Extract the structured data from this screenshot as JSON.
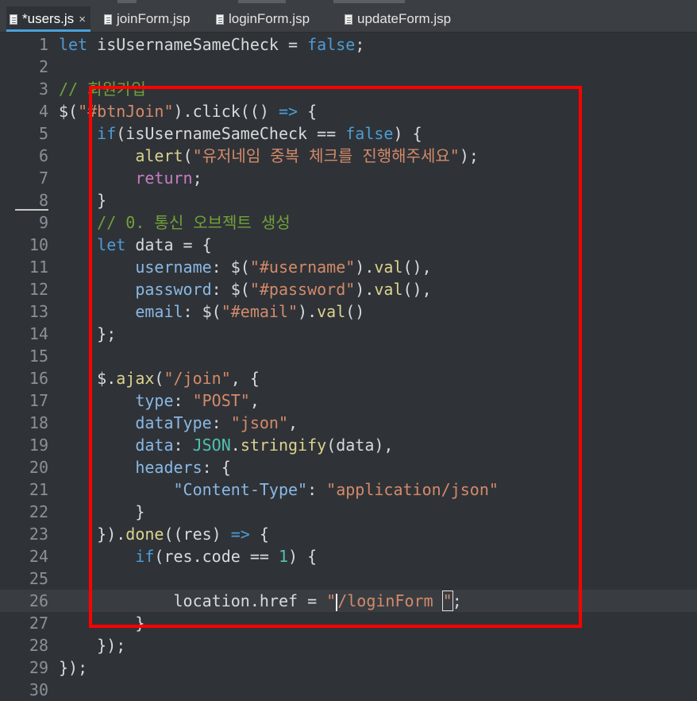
{
  "tabs": [
    {
      "label": "*users.js",
      "active": true,
      "closable": true,
      "icon": "js-file-icon"
    },
    {
      "label": "joinForm.jsp",
      "active": false,
      "icon": "jsp-file-icon"
    },
    {
      "label": "loginForm.jsp",
      "active": false,
      "icon": "jsp-file-icon"
    },
    {
      "label": "updateForm.jsp",
      "active": false,
      "icon": "jsp-file-icon"
    }
  ],
  "close_icon": "×",
  "editor": {
    "current_line": 26,
    "annotation_color": "#ff0000",
    "lines": [
      {
        "n": "1",
        "t": [
          [
            "kw",
            "let"
          ],
          [
            "",
            "isUsernameSameCheck"
          ],
          [
            "",
            "="
          ],
          [
            "kw",
            "false"
          ],
          [
            "",
            ";"
          ]
        ]
      },
      {
        "n": "2",
        "t": []
      },
      {
        "n": "3",
        "t": [
          [
            "cm",
            "// 회원가입"
          ]
        ]
      },
      {
        "n": "4",
        "t": [
          [
            "",
            "$("
          ],
          [
            "st",
            "\"#btnJoin\""
          ],
          [
            "",
            ").click(() "
          ],
          [
            "kw",
            "=>"
          ],
          [
            "",
            "{"
          ]
        ]
      },
      {
        "n": "5",
        "t": [
          [
            "",
            "    "
          ],
          [
            "kw",
            "if"
          ],
          [
            "",
            "(isUsernameSameCheck =="
          ],
          [
            "kw",
            "false"
          ],
          [
            "",
            ") {"
          ]
        ]
      },
      {
        "n": "6",
        "t": [
          [
            "",
            "        "
          ],
          [
            "fn",
            "alert"
          ],
          [
            "",
            "("
          ],
          [
            "st",
            "\"유저네임 중복 체크를 진행해주세요\""
          ],
          [
            "",
            ");"
          ]
        ]
      },
      {
        "n": "7",
        "t": [
          [
            "",
            "        "
          ],
          [
            "mg",
            "return"
          ],
          [
            "",
            ";"
          ]
        ]
      },
      {
        "n": "8",
        "t": [
          [
            "",
            "    }"
          ]
        ]
      },
      {
        "n": "9",
        "t": [
          [
            "",
            "    "
          ],
          [
            "cm",
            "// 0. 통신 오브젝트 생성"
          ]
        ]
      },
      {
        "n": "10",
        "t": [
          [
            "",
            "    "
          ],
          [
            "kw",
            "let"
          ],
          [
            "",
            "data = {"
          ]
        ]
      },
      {
        "n": "11",
        "t": [
          [
            "",
            "        "
          ],
          [
            "prop",
            "username"
          ],
          [
            "",
            ": $("
          ],
          [
            "st",
            "\"#username\""
          ],
          [
            "",
            ")."
          ],
          [
            "fn",
            "val"
          ],
          [
            "",
            "(),"
          ]
        ]
      },
      {
        "n": "12",
        "t": [
          [
            "",
            "        "
          ],
          [
            "prop",
            "password"
          ],
          [
            "",
            ": $("
          ],
          [
            "st",
            "\"#password\""
          ],
          [
            "",
            ")."
          ],
          [
            "fn",
            "val"
          ],
          [
            "",
            "(),"
          ]
        ]
      },
      {
        "n": "13",
        "t": [
          [
            "",
            "        "
          ],
          [
            "prop",
            "email"
          ],
          [
            "",
            ": $("
          ],
          [
            "st",
            "\"#email\""
          ],
          [
            "",
            ")."
          ],
          [
            "fn",
            "val"
          ],
          [
            "",
            "()"
          ]
        ]
      },
      {
        "n": "14",
        "t": [
          [
            "",
            "    };"
          ]
        ]
      },
      {
        "n": "15",
        "t": []
      },
      {
        "n": "16",
        "t": [
          [
            "",
            "    $."
          ],
          [
            "fn",
            "ajax"
          ],
          [
            "",
            "("
          ],
          [
            "st",
            "\"/join\""
          ],
          [
            "",
            ", {"
          ]
        ]
      },
      {
        "n": "17",
        "t": [
          [
            "",
            "        "
          ],
          [
            "prop",
            "type"
          ],
          [
            "",
            ": "
          ],
          [
            "st",
            "\"POST\""
          ],
          [
            "",
            ","
          ]
        ]
      },
      {
        "n": "18",
        "t": [
          [
            "",
            "        "
          ],
          [
            "prop",
            "dataType"
          ],
          [
            "",
            ": "
          ],
          [
            "st",
            "\"json\""
          ],
          [
            "",
            ","
          ]
        ]
      },
      {
        "n": "19",
        "t": [
          [
            "",
            "        "
          ],
          [
            "prop",
            "data"
          ],
          [
            "",
            ": "
          ],
          [
            "cy",
            "JSON"
          ],
          [
            "",
            "."
          ],
          [
            "fn",
            "stringify"
          ],
          [
            "",
            "(data),"
          ]
        ]
      },
      {
        "n": "20",
        "t": [
          [
            "",
            "        "
          ],
          [
            "prop",
            "headers"
          ],
          [
            "",
            ": {"
          ]
        ]
      },
      {
        "n": "21",
        "t": [
          [
            "",
            "            "
          ],
          [
            "prop",
            "\"Content-Type\""
          ],
          [
            "",
            ": "
          ],
          [
            "st",
            "\"application/json\""
          ]
        ]
      },
      {
        "n": "22",
        "t": [
          [
            "",
            "        }"
          ]
        ]
      },
      {
        "n": "23",
        "t": [
          [
            "",
            "    })."
          ],
          [
            "fn",
            "done"
          ],
          [
            "",
            "((res) "
          ],
          [
            "kw",
            "=>"
          ],
          [
            "",
            "{"
          ]
        ]
      },
      {
        "n": "24",
        "t": [
          [
            "",
            "        "
          ],
          [
            "kw",
            "if"
          ],
          [
            "",
            "(res.code =="
          ],
          [
            "cy",
            "1"
          ],
          [
            "",
            ") {"
          ]
        ]
      },
      {
        "n": "25",
        "t": []
      },
      {
        "n": "26",
        "t": [
          [
            "",
            "            location.href = "
          ],
          [
            "st",
            "\""
          ],
          [
            "caret",
            ""
          ],
          [
            "st",
            "/loginForm"
          ],
          [
            "box",
            "\""
          ],
          [
            "",
            ";"
          ]
        ]
      },
      {
        "n": "27",
        "t": [
          [
            "",
            "        }"
          ]
        ]
      },
      {
        "n": "28",
        "t": [
          [
            "",
            "    });"
          ]
        ]
      },
      {
        "n": "29",
        "t": [
          [
            "",
            "});"
          ]
        ]
      },
      {
        "n": "30",
        "t": []
      }
    ]
  }
}
